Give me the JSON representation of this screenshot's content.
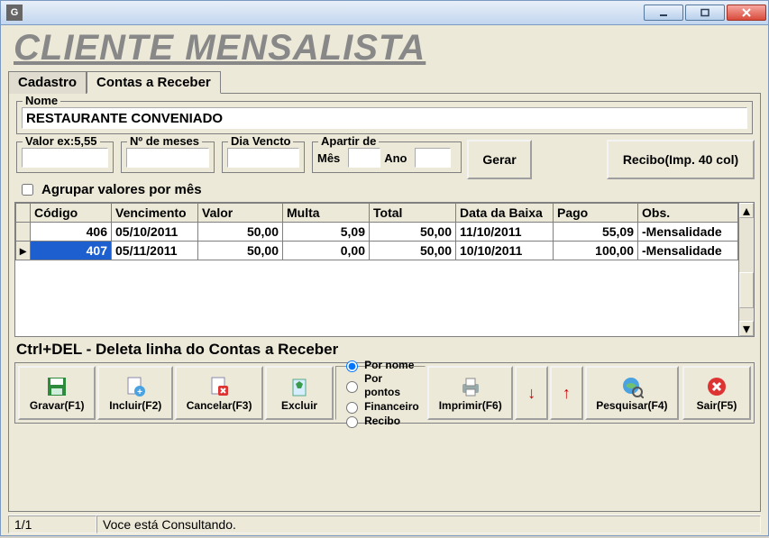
{
  "window": {
    "title": "CLIENTE MENSALISTA"
  },
  "tabs": {
    "t0": "Cadastro",
    "t1": "Contas a Receber"
  },
  "nome": {
    "label": "Nome",
    "value": "RESTAURANTE CONVENIADO"
  },
  "fields": {
    "valor_label": "Valor  ex:5,55",
    "valor_value": "",
    "nmeses_label": "Nº de meses",
    "nmeses_value": "",
    "diavencto_label": "Dia Vencto",
    "diavencto_value": "",
    "apartir_label": "Apartir de",
    "mes_label": "Mês",
    "mes_value": "",
    "ano_label": "Ano",
    "ano_value": ""
  },
  "buttons": {
    "gerar": "Gerar",
    "recibo": "Recibo(Imp. 40 col)"
  },
  "group_checkbox": "Agrupar valores por mês",
  "grid": {
    "headers": {
      "codigo": "Código",
      "venc": "Vencimento",
      "valor": "Valor",
      "multa": "Multa",
      "total": "Total",
      "databaixa": "Data da Baixa",
      "pago": "Pago",
      "obs": "Obs."
    },
    "rows": [
      {
        "codigo": "406",
        "venc": "05/10/2011",
        "valor": "50,00",
        "multa": "5,09",
        "total": "50,00",
        "databaixa": "11/10/2011",
        "pago": "55,09",
        "obs": "-Mensalidade"
      },
      {
        "codigo": "407",
        "venc": "05/11/2011",
        "valor": "50,00",
        "multa": "0,00",
        "total": "50,00",
        "databaixa": "10/10/2011",
        "pago": "100,00",
        "obs": "-Mensalidade"
      }
    ]
  },
  "hint": "Ctrl+DEL - Deleta linha do Contas a Receber",
  "toolbar": {
    "gravar": "Gravar(F1)",
    "incluir": "Incluir(F2)",
    "cancelar": "Cancelar(F3)",
    "excluir": "Excluir",
    "imprimir": "Imprimir(F6)",
    "pesquisar": "Pesquisar(F4)",
    "sair": "Sair(F5)",
    "radios": {
      "pornome": "Por nome",
      "porpontos": "Por pontos",
      "financeiro": "Financeiro",
      "recibo": "Recibo"
    }
  },
  "status": {
    "pos": "1/1",
    "msg": "Voce está Consultando."
  }
}
